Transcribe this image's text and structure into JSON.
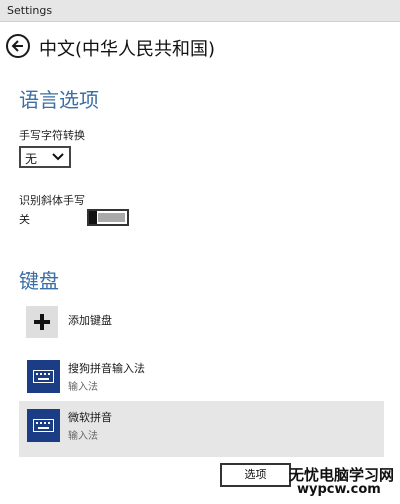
{
  "window": {
    "title": "Settings"
  },
  "header": {
    "title": "中文(中华人民共和国)"
  },
  "language_options": {
    "heading": "语言选项",
    "handwriting_conversion": {
      "label": "手写字符转换",
      "value": "无"
    },
    "italic_recognition": {
      "label": "识别斜体手写",
      "state_label": "关",
      "on": false
    }
  },
  "keyboards": {
    "heading": "键盘",
    "add_label": "添加键盘",
    "items": [
      {
        "name": "搜狗拼音输入法",
        "type": "输入法",
        "selected": false
      },
      {
        "name": "微软拼音",
        "type": "输入法",
        "selected": true
      }
    ],
    "options_button": "选项"
  },
  "watermark": {
    "line1": "无忧电脑学习网",
    "line2": "wypcw.com"
  },
  "colors": {
    "accent": "#3b6ea5",
    "keyboard_icon": "#1b3d85",
    "selected_row": "#e6e6e6"
  }
}
